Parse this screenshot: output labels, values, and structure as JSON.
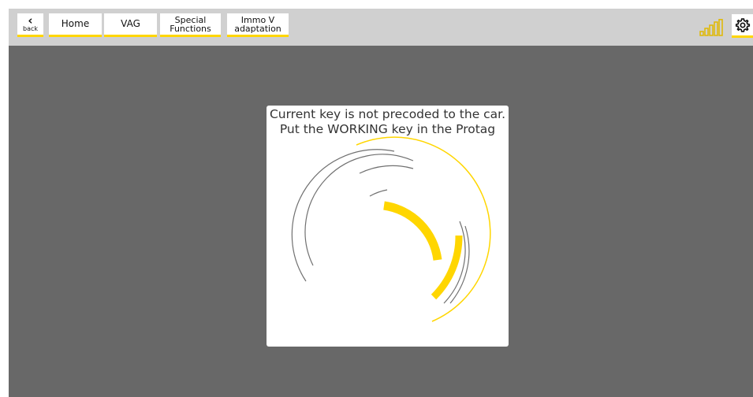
{
  "toolbar": {
    "back_label": "back",
    "tabs": [
      {
        "label": "Home"
      },
      {
        "label": "VAG"
      },
      {
        "label": "Special Functions"
      },
      {
        "label": "Immo V adaptation"
      }
    ]
  },
  "icons": {
    "back": "chevron-left-icon",
    "signal": "signal-strength-icon",
    "settings": "gear-icon"
  },
  "dialog": {
    "line1": "Current key is not precoded to the car.",
    "line2": "Put the WORKING key in the Protag"
  },
  "colors": {
    "accent": "#ffd600",
    "toolbar_bg": "#d0d0d0",
    "content_bg": "#686868",
    "dialog_bg": "#ffffff",
    "arc_gray": "#707070"
  }
}
